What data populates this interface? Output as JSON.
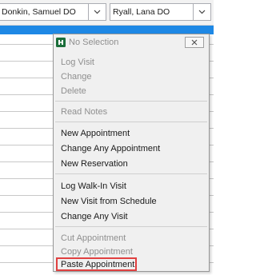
{
  "providers": {
    "left": {
      "value": "Donkin, Samuel  DO"
    },
    "right": {
      "value": "Ryall, Lana  DO"
    }
  },
  "colors": {
    "header_blue": "#1e88e5",
    "highlight_red": "#e04040",
    "app_icon_green": "#1b6e3a"
  },
  "context_menu": {
    "title": "No Selection",
    "items": {
      "log_visit": "Log Visit",
      "change": "Change",
      "delete": "Delete",
      "read_notes": "Read Notes",
      "new_appointment": "New Appointment",
      "change_any_appointment": "Change Any Appointment",
      "new_reservation": "New Reservation",
      "log_walk_in_visit": "Log Walk-In Visit",
      "new_visit_from_schedule": "New Visit from Schedule",
      "change_any_visit": "Change Any Visit",
      "cut_appointment": "Cut Appointment",
      "copy_appointment": "Copy Appointment",
      "paste_appointment": "Paste Appointment"
    },
    "icons": {
      "app": "app-logo-icon",
      "close": "close-icon"
    }
  }
}
